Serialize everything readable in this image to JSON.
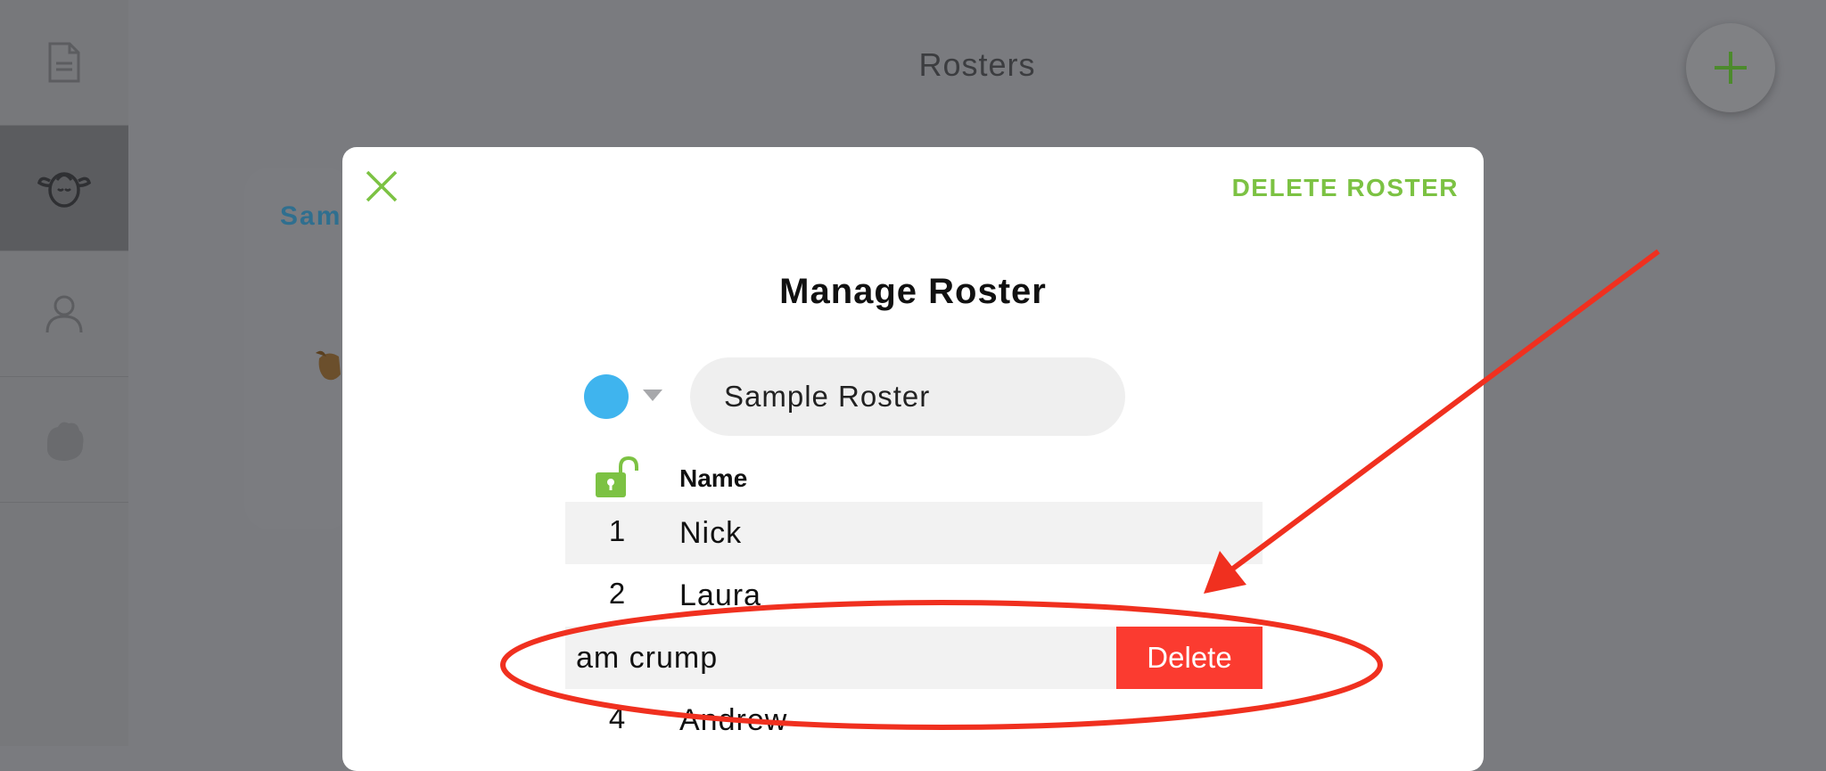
{
  "header": {
    "title": "Rosters",
    "add_icon": "plus-icon"
  },
  "sidebar": {
    "items": [
      {
        "icon": "document-icon",
        "active": false
      },
      {
        "icon": "sheep-icon",
        "active": true
      },
      {
        "icon": "person-icon",
        "active": false
      },
      {
        "icon": "hand-icon",
        "active": false
      }
    ]
  },
  "background_card": {
    "title": "Sam"
  },
  "modal": {
    "delete_roster_label": "DELETE ROSTER",
    "title": "Manage Roster",
    "roster_color": "#3fb4ee",
    "roster_name": "Sample Roster",
    "column_header": "Name",
    "rows": [
      {
        "num": "1",
        "name": "Nick"
      },
      {
        "num": "2",
        "name": "Laura"
      },
      {
        "num": "",
        "name": "am crump",
        "swiped": true,
        "action": "Delete"
      },
      {
        "num": "4",
        "name": "Andrew"
      }
    ]
  },
  "colors": {
    "accent_green": "#7cc243",
    "delete_red": "#fb3b30",
    "annotation_red": "#f0301f"
  }
}
